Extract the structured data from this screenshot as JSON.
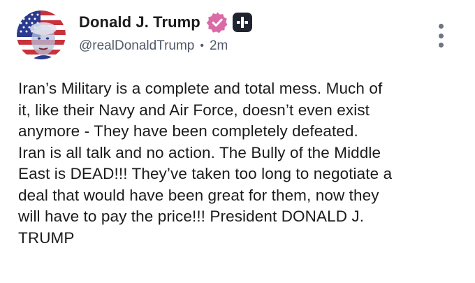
{
  "post": {
    "author": {
      "display_name": "Donald J. Trump",
      "handle": "@realDonaldTrump",
      "avatar_icon": "flag-portrait-avatar",
      "verified_icon": "verified-badge-icon",
      "plus_icon": "plus-badge-icon"
    },
    "separator": "•",
    "timestamp": "2m",
    "menu_icon": "more-vertical-icon",
    "body_lines": [
      "Iran’s Military is a complete and total mess. Much of",
      "it, like their Navy and Air Force, doesn’t even exist",
      "anymore - They have been completely defeated.",
      "Iran is all talk and no action. The Bully of the Middle",
      "East is DEAD!!! They’ve taken too long to negotiate a",
      "deal that would have been great for them, now they",
      "will have to pay the price!!! President DONALD J.",
      "TRUMP"
    ]
  },
  "colors": {
    "text": "#1b1b1b",
    "secondary_text": "#505a66",
    "verified_badge": "#d96ba6",
    "plus_badge": "#1f2430",
    "flag_blue": "#2b3a8f",
    "flag_red": "#c8323c"
  }
}
